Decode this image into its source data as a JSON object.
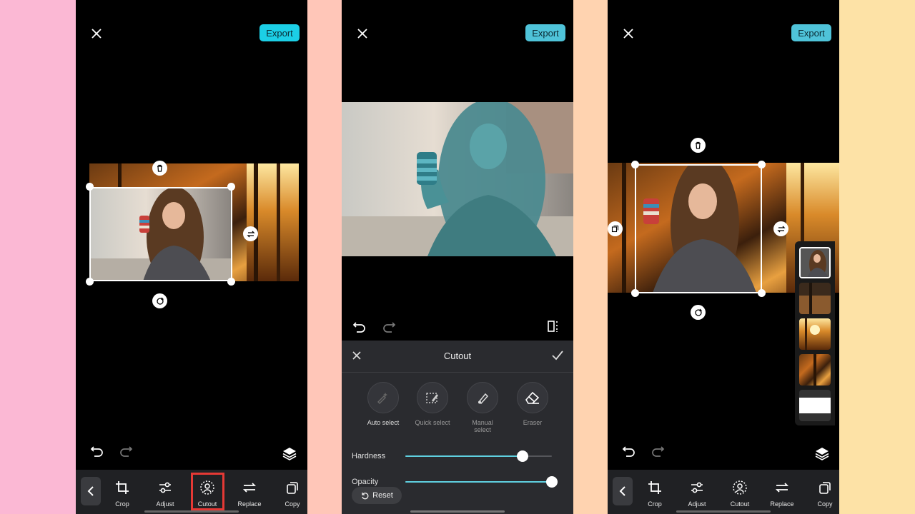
{
  "background": {
    "colors": [
      "#fbb8d4",
      "#ffc6b8",
      "#ffd3b0",
      "#fde2a6"
    ]
  },
  "colors": {
    "export_bg": "#1ccfe6",
    "accent_track": "#5fd0e0",
    "highlight": "#e53935",
    "toolbar_bg": "#202124",
    "panel_bg": "#2a2b2f"
  },
  "screen1": {
    "export_label": "Export",
    "tools": [
      {
        "label": "Crop",
        "icon": "crop-icon"
      },
      {
        "label": "Adjust",
        "icon": "sliders-icon"
      },
      {
        "label": "Cutout",
        "icon": "cutout-icon",
        "highlighted": true
      },
      {
        "label": "Replace",
        "icon": "replace-icon"
      },
      {
        "label": "Copy",
        "icon": "copy-icon"
      }
    ]
  },
  "screen2": {
    "export_label": "Export",
    "panel": {
      "title": "Cutout",
      "options": [
        {
          "label": "Auto select",
          "icon": "auto-select-icon"
        },
        {
          "label": "Quick select",
          "icon": "quick-select-icon"
        },
        {
          "label": "Manual select",
          "icon": "manual-select-icon"
        },
        {
          "label": "Eraser",
          "icon": "eraser-icon"
        }
      ],
      "hardness_label": "Hardness",
      "hardness_value": 0.8,
      "opacity_label": "Opacity",
      "opacity_value": 1.0,
      "reset_label": "Reset"
    }
  },
  "screen3": {
    "export_label": "Export",
    "tools": [
      {
        "label": "Crop",
        "icon": "crop-icon"
      },
      {
        "label": "Adjust",
        "icon": "sliders-icon"
      },
      {
        "label": "Cutout",
        "icon": "cutout-icon"
      },
      {
        "label": "Replace",
        "icon": "replace-icon"
      },
      {
        "label": "Copy",
        "icon": "copy-icon"
      }
    ]
  }
}
